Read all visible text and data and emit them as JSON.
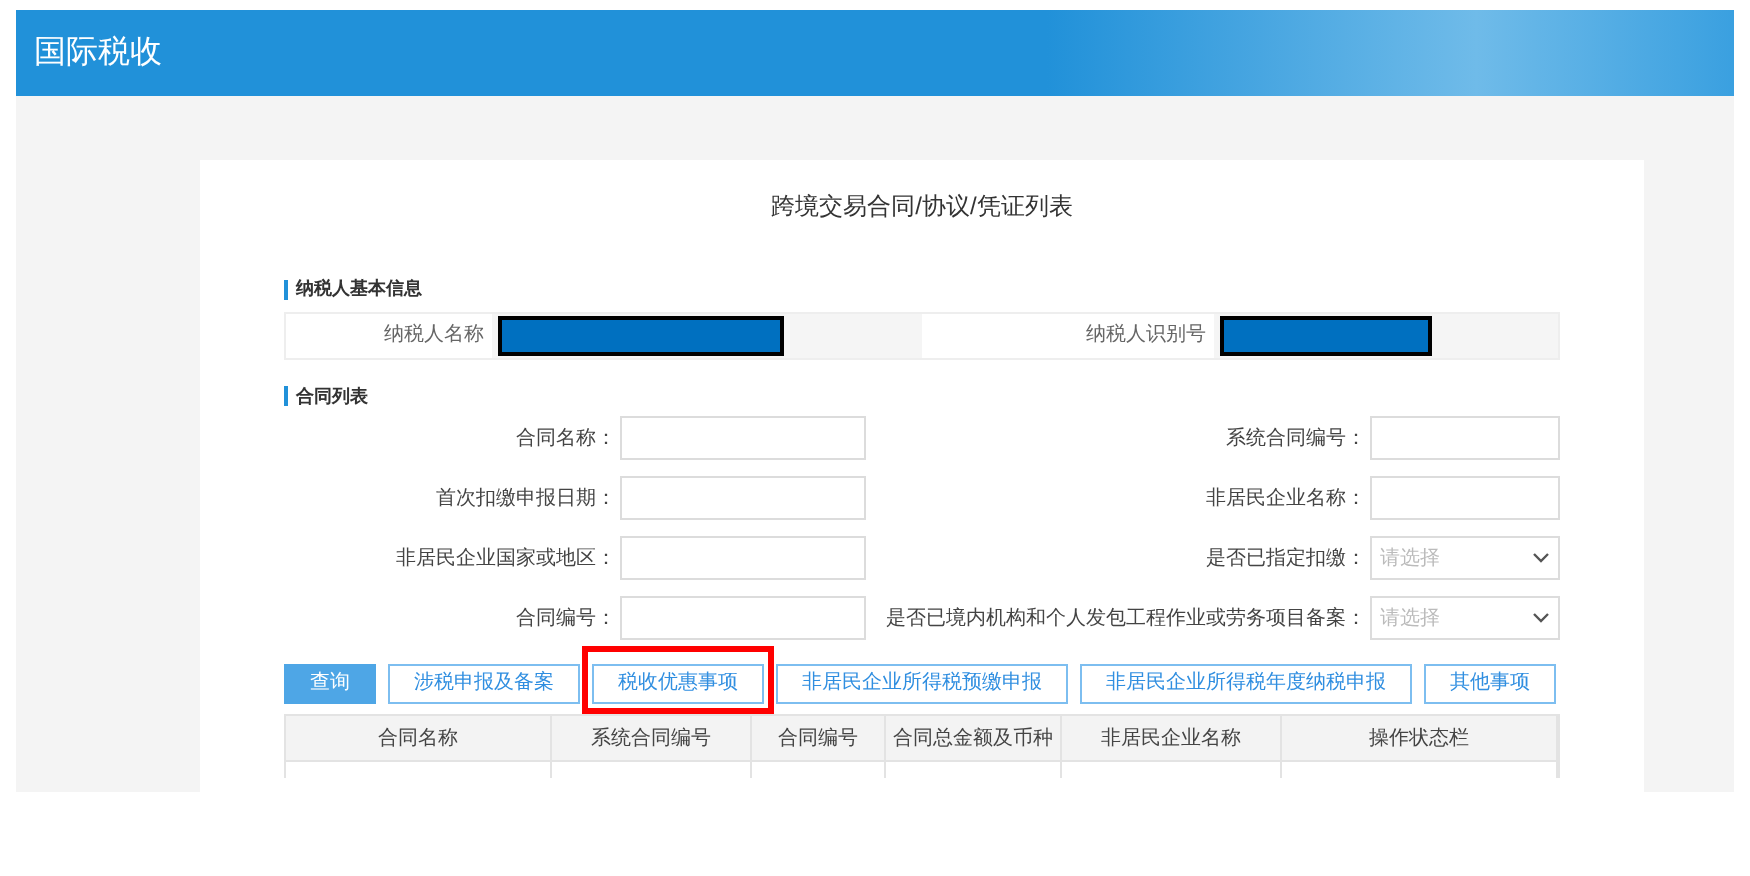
{
  "header": {
    "title": "国际税收"
  },
  "page_title": "跨境交易合同/协议/凭证列表",
  "taxpayer_section": {
    "title": "纳税人基本信息",
    "fields": [
      {
        "label": "纳税人名称",
        "redacted": true
      },
      {
        "label": "纳税人识别号",
        "redacted": true
      }
    ]
  },
  "contract_section": {
    "title": "合同列表",
    "filters": [
      {
        "label": "合同名称：",
        "kind": "input"
      },
      {
        "label": "系统合同编号：",
        "kind": "input"
      },
      {
        "label": "首次扣缴申报日期：",
        "kind": "input"
      },
      {
        "label": "非居民企业名称：",
        "kind": "input"
      },
      {
        "label": "非居民企业国家或地区：",
        "kind": "input"
      },
      {
        "label": "是否已指定扣缴：",
        "kind": "select",
        "placeholder": "请选择"
      },
      {
        "label": "合同编号：",
        "kind": "input"
      },
      {
        "label": "是否已境内机构和个人发包工程作业或劳务项目备案：",
        "kind": "select",
        "placeholder": "请选择"
      }
    ],
    "buttons": [
      {
        "label": "查询",
        "primary": true,
        "highlighted": false
      },
      {
        "label": "涉税申报及备案",
        "primary": false,
        "highlighted": false
      },
      {
        "label": "税收优惠事项",
        "primary": false,
        "highlighted": true
      },
      {
        "label": "非居民企业所得税预缴申报",
        "primary": false,
        "highlighted": false
      },
      {
        "label": "非居民企业所得税年度纳税申报",
        "primary": false,
        "highlighted": false
      },
      {
        "label": "其他事项",
        "primary": false,
        "highlighted": false
      }
    ],
    "table": {
      "columns": [
        "合同名称",
        "系统合同编号",
        "合同编号",
        "合同总金额及币种",
        "非居民企业名称",
        "操作状态栏"
      ]
    }
  }
}
